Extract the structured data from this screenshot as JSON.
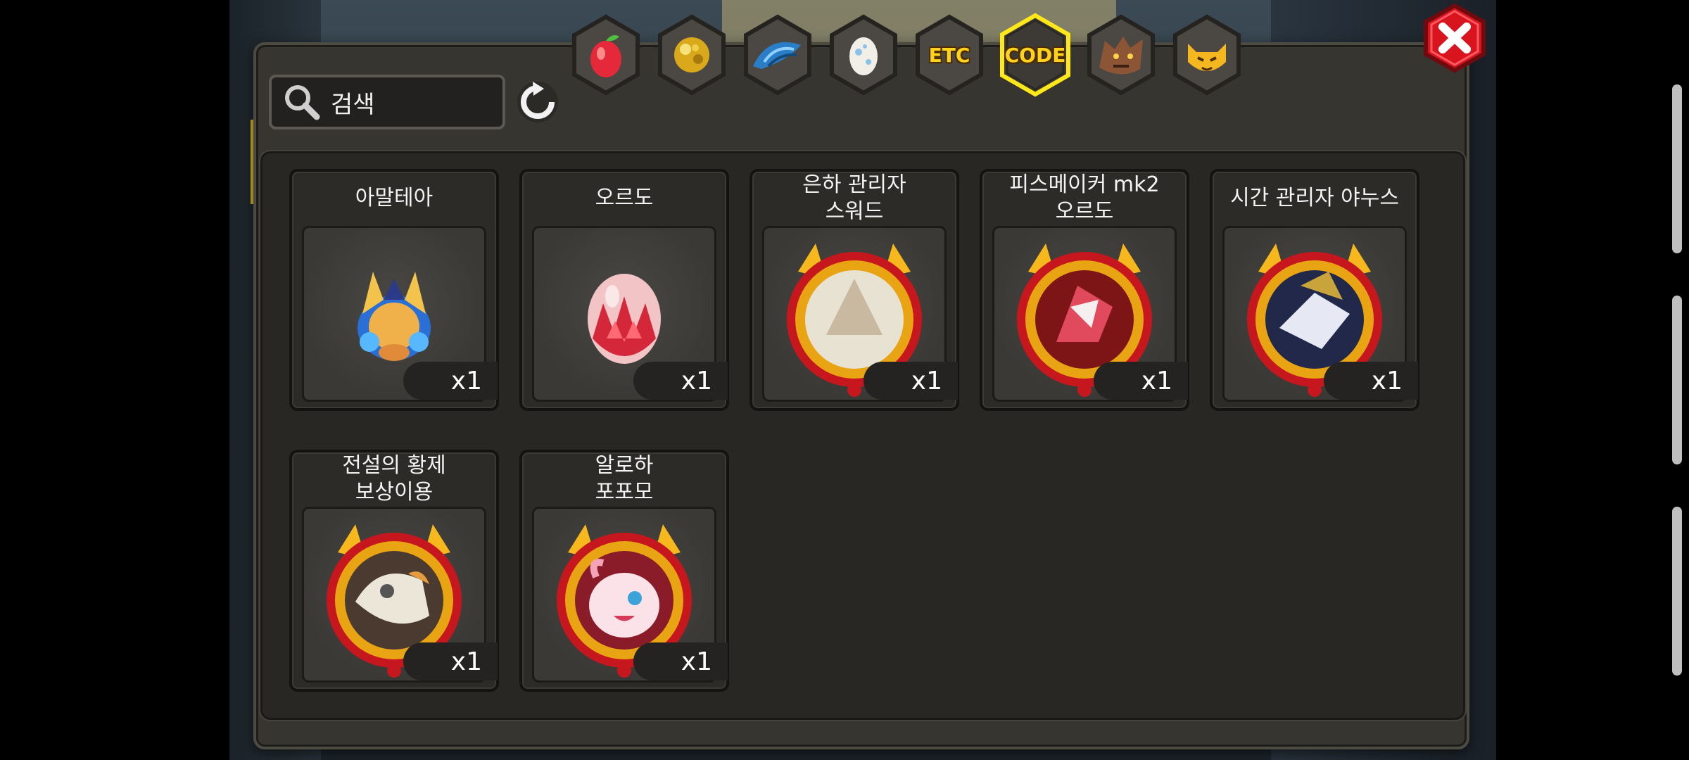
{
  "search": {
    "placeholder": "검색"
  },
  "tabs": [
    {
      "name": "fruit",
      "icon": "red-fruit-icon"
    },
    {
      "name": "gold",
      "icon": "gold-nugget-icon"
    },
    {
      "name": "scale",
      "icon": "blue-scale-icon"
    },
    {
      "name": "egg",
      "icon": "egg-icon"
    },
    {
      "name": "etc",
      "label": "ETC"
    },
    {
      "name": "code",
      "label": "CODE",
      "selected": true
    },
    {
      "name": "beast",
      "icon": "beast-icon"
    },
    {
      "name": "pet",
      "icon": "yellow-pet-icon"
    }
  ],
  "items": [
    {
      "name": "아말테아",
      "qty": "x1",
      "icon": "dragon-egg-icon"
    },
    {
      "name": "오르도",
      "qty": "x1",
      "icon": "red-egg-icon"
    },
    {
      "name": "은하 관리자\n스워드",
      "qty": "x1",
      "icon": "gold-crest-icon"
    },
    {
      "name": "피스메이커 mk2\n오르도",
      "qty": "x1",
      "icon": "gold-crest-icon"
    },
    {
      "name": "시간 관리자 야누스",
      "qty": "x1",
      "icon": "gold-crest-icon"
    },
    {
      "name": "전설의 황제\n보상이용",
      "qty": "x1",
      "icon": "gold-crest-icon"
    },
    {
      "name": "알로하\n포포모",
      "qty": "x1",
      "icon": "gold-crest-icon"
    }
  ],
  "colors": {
    "accent": "#ffd21c",
    "close": "#d8151f"
  }
}
